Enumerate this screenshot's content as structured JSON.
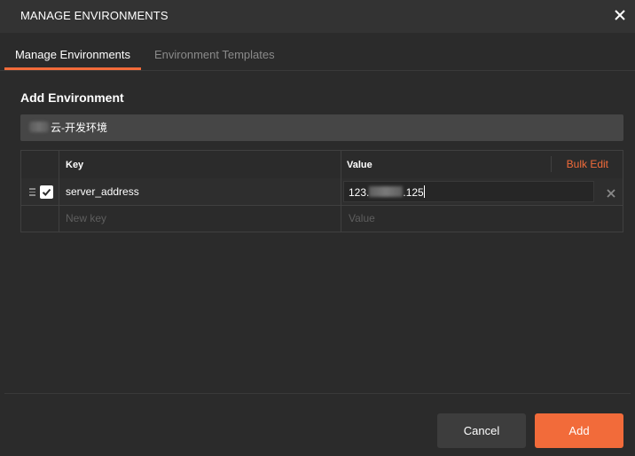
{
  "dialog": {
    "title": "MANAGE ENVIRONMENTS"
  },
  "tabs": [
    {
      "label": "Manage Environments",
      "active": true
    },
    {
      "label": "Environment Templates",
      "active": false
    }
  ],
  "form": {
    "section_title": "Add Environment",
    "env_name_value": "云-开发环境"
  },
  "table": {
    "key_header": "Key",
    "value_header": "Value",
    "bulk_edit_label": "Bulk Edit",
    "rows": [
      {
        "enabled": true,
        "key": "server_address",
        "value_prefix": "123.",
        "value_suffix": ".125"
      }
    ],
    "new_key_placeholder": "New key",
    "new_value_placeholder": "Value"
  },
  "footer": {
    "cancel_label": "Cancel",
    "add_label": "Add"
  },
  "colors": {
    "accent": "#f26b3a",
    "background": "#2b2b2b",
    "titlebar": "#333333"
  }
}
